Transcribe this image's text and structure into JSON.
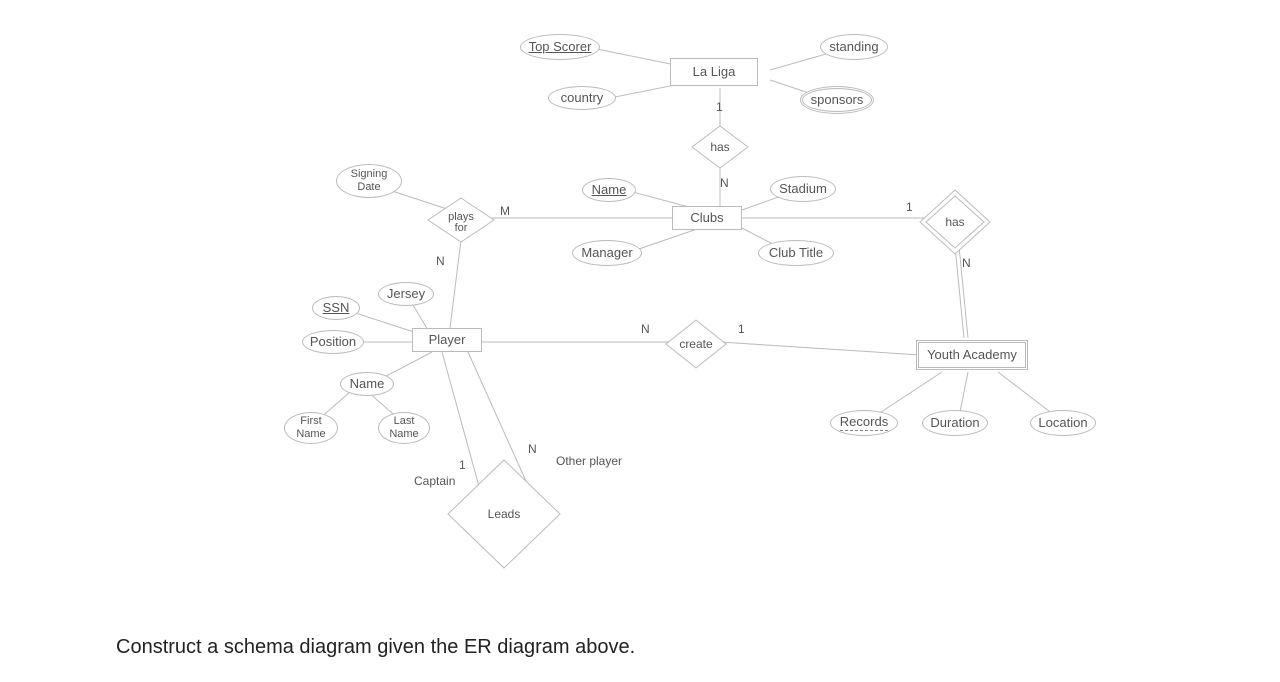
{
  "entities": {
    "laliga": "La Liga",
    "clubs": "Clubs",
    "player": "Player",
    "youth_academy": "Youth Academy"
  },
  "relationships": {
    "has_league_clubs": "has",
    "plays_for": "plays for",
    "create": "create",
    "has_clubs_youth": "has",
    "leads": "Leads"
  },
  "attributes": {
    "top_scorer": "Top Scorer",
    "country": "country",
    "standing": "standing",
    "sponsors": "sponsors",
    "signing_date": "Signing Date",
    "name_club": "Name",
    "stadium": "Stadium",
    "manager": "Manager",
    "club_title": "Club Title",
    "ssn": "SSN",
    "jersey": "Jersey",
    "position": "Position",
    "name_player": "Name",
    "first_name": "First Name",
    "last_name": "Last Name",
    "records": "Records",
    "duration": "Duration",
    "location": "Location"
  },
  "cardinalities": {
    "laliga_has": "1",
    "clubs_has_n": "N",
    "playsfor_m": "M",
    "playsfor_n": "N",
    "create_n": "N",
    "create_1": "1",
    "has_youth_1": "1",
    "has_youth_n": "N",
    "captain_1": "1",
    "other_n": "N"
  },
  "roles": {
    "captain": "Captain",
    "other_player": "Other player"
  },
  "question": "Construct a schema diagram given the ER diagram above."
}
